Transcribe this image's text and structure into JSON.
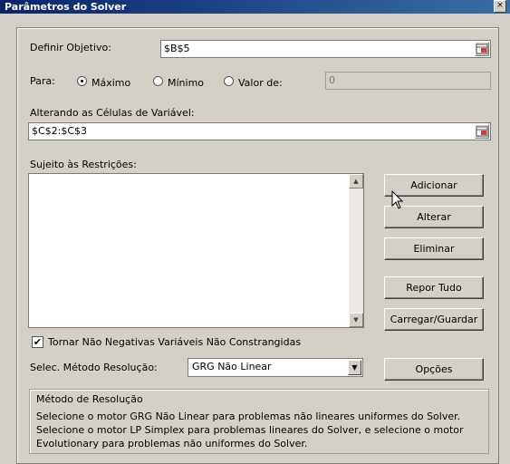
{
  "window": {
    "title": "Parâmetros do Solver",
    "close_glyph": "×"
  },
  "objective": {
    "label": "Definir Objetivo:",
    "value": "$B$5"
  },
  "para": {
    "label": "Para:",
    "options": [
      {
        "label": "Máximo",
        "selected": true
      },
      {
        "label": "Mínimo",
        "selected": false
      },
      {
        "label": "Valor de:",
        "selected": false
      }
    ],
    "value_of": "0"
  },
  "variable_cells": {
    "label": "Alterando as Células de Variável:",
    "value": "$C$2:$C$3"
  },
  "constraints": {
    "label": "Sujeito às Restrições:",
    "items": [],
    "scroll_up": "▲",
    "scroll_down": "▼"
  },
  "buttons": {
    "add": "Adicionar",
    "change": "Alterar",
    "delete": "Eliminar",
    "reset_all": "Repor Tudo",
    "load_save": "Carregar/Guardar",
    "options": "Opções"
  },
  "nonneg": {
    "label": "Tornar Não Negativas Variáveis Não Constrangidas",
    "checked": true,
    "check_glyph": "✔"
  },
  "method": {
    "label": "Selec. Método Resolução:",
    "selected": "GRG Não Linear",
    "dropdown_glyph": "▼"
  },
  "method_group": {
    "title": "Método de Resolução",
    "description": "Selecione o motor GRG Não Linear para problemas não lineares uniformes do Solver. Selecione o motor LP Simplex para problemas lineares do Solver, e selecione o motor Evolutionary para problemas não uniformes do Solver."
  },
  "icons": {
    "ref": "range-ref-icon",
    "cursor": "mouse-pointer-icon"
  }
}
